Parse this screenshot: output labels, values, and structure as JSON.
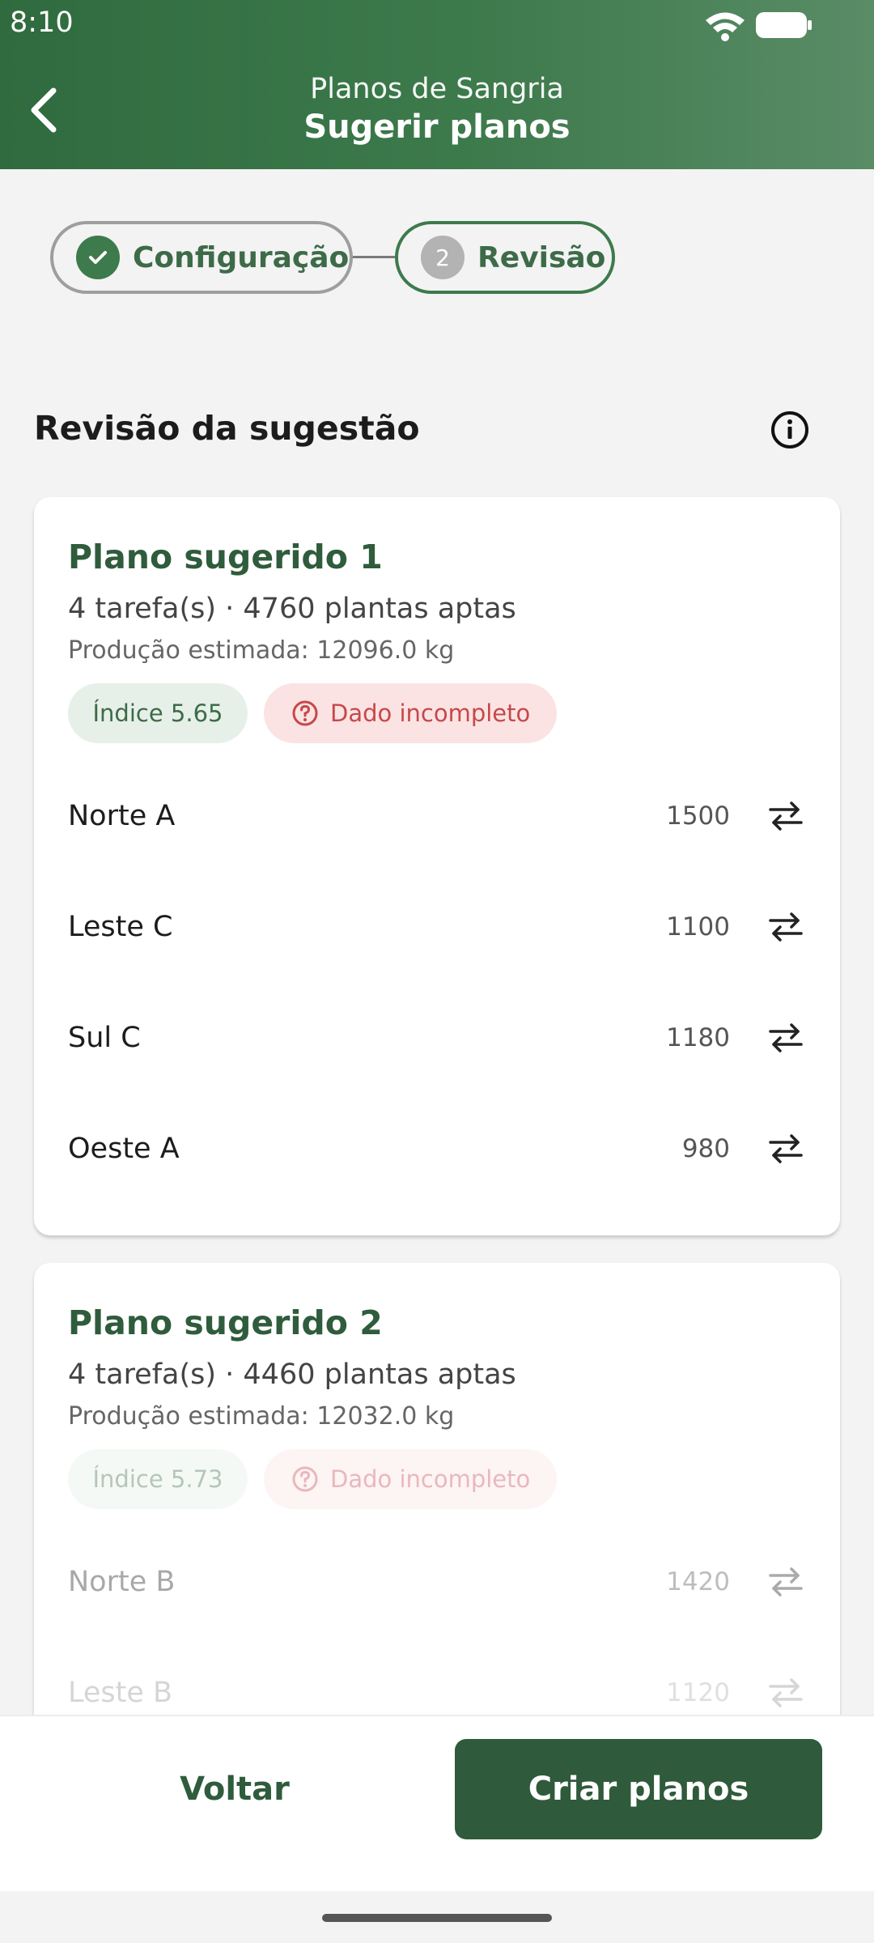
{
  "status_bar": {
    "time": "8:10"
  },
  "header": {
    "title": "Planos de Sangria",
    "subtitle": "Sugerir planos"
  },
  "stepper": {
    "steps": [
      {
        "label": "Configuração",
        "state": "done"
      },
      {
        "number": "2",
        "label": "Revisão",
        "state": "current"
      }
    ]
  },
  "section": {
    "title": "Revisão da sugestão"
  },
  "plans": [
    {
      "title": "Plano sugerido 1",
      "meta": "4 tarefa(s) · 4760 plantas aptas",
      "production": "Produção estimada: 12096.0 kg",
      "index_badge": "Índice 5.65",
      "warning_badge": "Dado incompleto",
      "rows": [
        {
          "name": "Norte A",
          "value": "1500"
        },
        {
          "name": "Leste C",
          "value": "1100"
        },
        {
          "name": "Sul C",
          "value": "1180"
        },
        {
          "name": "Oeste A",
          "value": "980"
        }
      ]
    },
    {
      "title": "Plano sugerido 2",
      "meta": "4 tarefa(s) · 4460 plantas aptas",
      "production": "Produção estimada: 12032.0 kg",
      "index_badge": "Índice 5.73",
      "warning_badge": "Dado incompleto",
      "rows": [
        {
          "name": "Norte B",
          "value": "1420"
        },
        {
          "name": "Leste B",
          "value": "1120"
        }
      ]
    }
  ],
  "actions": {
    "back_label": "Voltar",
    "create_label": "Criar planos"
  },
  "colors": {
    "primary": "#2f5a3b",
    "header_green": "#3d7a4c",
    "warning": "#c7484a",
    "index_bg": "#e6f0e8"
  }
}
